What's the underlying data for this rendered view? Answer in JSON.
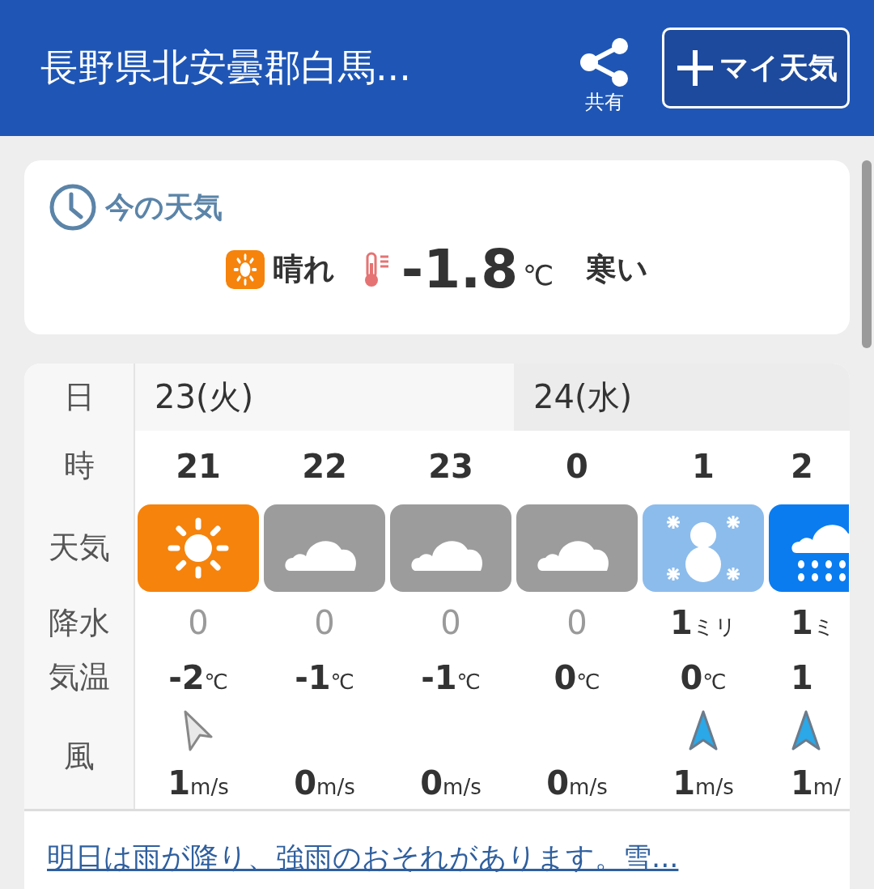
{
  "header": {
    "title": "長野県北安曇郡白馬...",
    "share_label": "共有",
    "add_button": "マイ天気"
  },
  "current": {
    "title": "今の天気",
    "icon": {
      "kind": "sunny"
    },
    "weather": "晴れ",
    "temperature": "-1.8",
    "temp_unit": "℃",
    "feeling": "寒い"
  },
  "forecast": {
    "row_labels": [
      "日",
      "時",
      "天気",
      "降水",
      "気温",
      "風"
    ],
    "days": [
      {
        "label": "23(火)",
        "hours": [
          {
            "hour": "21",
            "icon": {
              "kind": "sunny"
            },
            "precip": "0",
            "temp": "-2",
            "temp_unit": "℃",
            "wind_arrow": {
              "kind": "grey"
            },
            "wind": "1",
            "wind_unit": "m/s"
          },
          {
            "hour": "22",
            "icon": {
              "kind": "cloudy"
            },
            "precip": "0",
            "temp": "-1",
            "temp_unit": "℃",
            "wind": "0",
            "wind_unit": "m/s"
          },
          {
            "hour": "23",
            "icon": {
              "kind": "cloudy"
            },
            "precip": "0",
            "temp": "-1",
            "temp_unit": "℃",
            "wind": "0",
            "wind_unit": "m/s"
          }
        ]
      },
      {
        "label": "24(水)",
        "hours": [
          {
            "hour": "0",
            "icon": {
              "kind": "cloudy"
            },
            "precip": "0",
            "temp": "0",
            "temp_unit": "℃",
            "wind": "0",
            "wind_unit": "m/s"
          },
          {
            "hour": "1",
            "icon": {
              "kind": "snow"
            },
            "precip": "1",
            "precip_unit": "ミリ",
            "temp": "0",
            "temp_unit": "℃",
            "wind_arrow": {
              "kind": "blue"
            },
            "wind": "1",
            "wind_unit": "m/s"
          },
          {
            "hour": "2",
            "icon": {
              "kind": "rain"
            },
            "precip": "1",
            "precip_unit": "ミ",
            "temp": "1",
            "wind_arrow": {
              "kind": "blue"
            },
            "wind": "1",
            "wind_unit": "m/"
          }
        ]
      }
    ],
    "summary_link": "明日は雨が降り、強雨のおそれがあります。雪..."
  }
}
